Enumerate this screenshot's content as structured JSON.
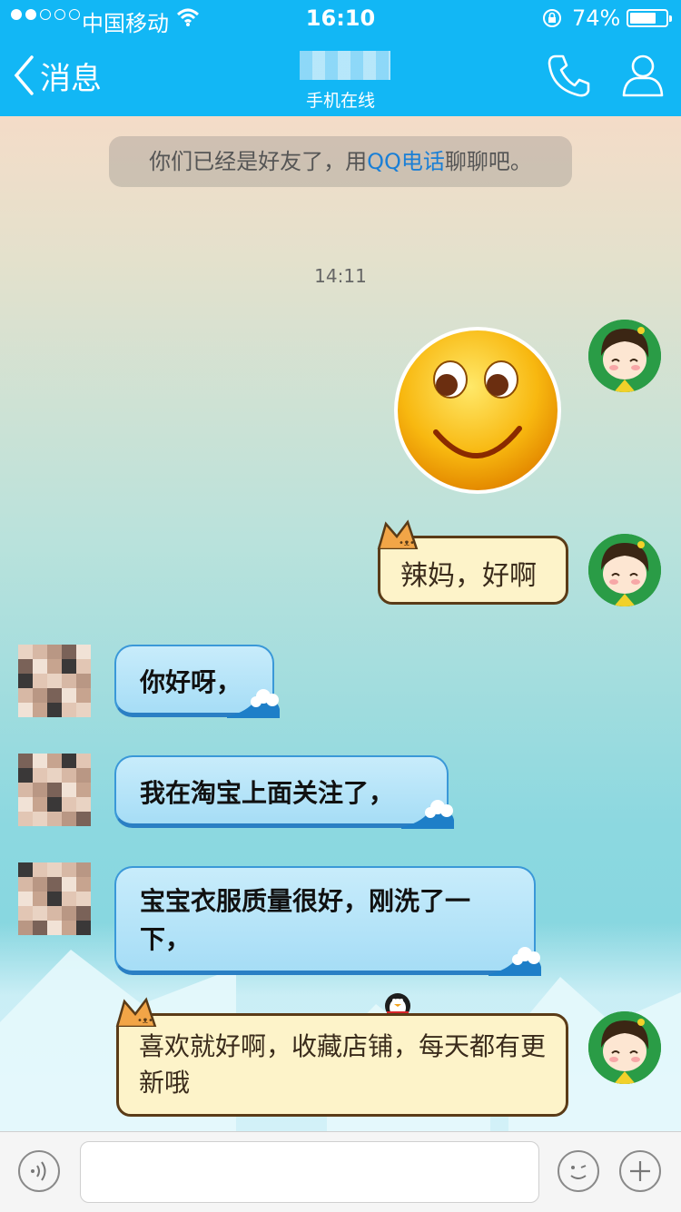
{
  "status_bar": {
    "carrier": "中国移动",
    "time": "16:10",
    "battery_percent": "74%",
    "battery_level": 0.74,
    "signal_bars_filled": 2,
    "signal_bars_total": 5
  },
  "header": {
    "back_label": "消息",
    "subtitle": "手机在线",
    "icons": [
      "phone-icon",
      "profile-icon"
    ],
    "accent_color": "#12b7f5"
  },
  "chat": {
    "notice_before": "你们已经是好友了，用",
    "notice_link": "QQ电话",
    "notice_after": "聊聊吧。",
    "timestamp": "14:11",
    "messages": [
      {
        "side": "right",
        "type": "emoji",
        "emoji": "smile-emoji"
      },
      {
        "side": "right",
        "type": "text",
        "style": "cat",
        "text": "辣妈，好啊"
      },
      {
        "side": "left",
        "type": "text",
        "style": "sea",
        "text": "你好呀，"
      },
      {
        "side": "left",
        "type": "text",
        "style": "sea",
        "text": "我在淘宝上面关注了，"
      },
      {
        "side": "left",
        "type": "text",
        "style": "sea",
        "text": "宝宝衣服质量很好，刚洗了一下，"
      },
      {
        "side": "right",
        "type": "text",
        "style": "cat",
        "text": "喜欢就好啊，收藏店铺，每天都有更新哦"
      }
    ]
  },
  "input_bar": {
    "left_icon": "voice-icon",
    "right_icons": [
      "emoji-face-icon",
      "plus-icon"
    ],
    "placeholder": ""
  }
}
